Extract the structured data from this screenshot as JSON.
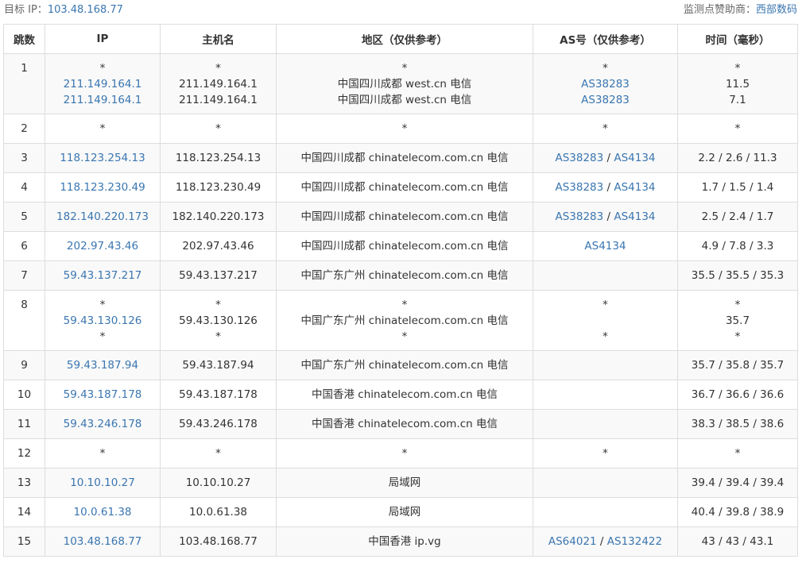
{
  "header": {
    "target_label": "目标 IP：",
    "target_ip": "103.48.168.77",
    "sponsor_label": "监测点赞助商：",
    "sponsor_name": "西部数码"
  },
  "columns": [
    "跳数",
    "IP",
    "主机名",
    "地区（仅供参考）",
    "AS号（仅供参考）",
    "时间（毫秒）"
  ],
  "rows": [
    {
      "hop": "1",
      "ip": [
        "*",
        "211.149.164.1",
        "211.149.164.1"
      ],
      "host": [
        "*",
        "211.149.164.1",
        "211.149.164.1"
      ],
      "region": [
        "*",
        "中国四川成都 west.cn 电信",
        "中国四川成都 west.cn 电信"
      ],
      "as": [
        [
          "*"
        ],
        [
          "AS38283"
        ],
        [
          "AS38283"
        ]
      ],
      "time": [
        "*",
        "11.5",
        "7.1"
      ]
    },
    {
      "hop": "2",
      "ip": [
        "*"
      ],
      "host": [
        "*"
      ],
      "region": [
        "*"
      ],
      "as": [
        [
          "*"
        ]
      ],
      "time": [
        "*"
      ]
    },
    {
      "hop": "3",
      "ip": [
        "118.123.254.13"
      ],
      "host": [
        "118.123.254.13"
      ],
      "region": [
        "中国四川成都 chinatelecom.com.cn 电信"
      ],
      "as": [
        [
          "AS38283",
          "AS4134"
        ]
      ],
      "time": [
        "2.2 / 2.6 / 11.3"
      ]
    },
    {
      "hop": "4",
      "ip": [
        "118.123.230.49"
      ],
      "host": [
        "118.123.230.49"
      ],
      "region": [
        "中国四川成都 chinatelecom.com.cn 电信"
      ],
      "as": [
        [
          "AS38283",
          "AS4134"
        ]
      ],
      "time": [
        "1.7 / 1.5 / 1.4"
      ]
    },
    {
      "hop": "5",
      "ip": [
        "182.140.220.173"
      ],
      "host": [
        "182.140.220.173"
      ],
      "region": [
        "中国四川成都 chinatelecom.com.cn 电信"
      ],
      "as": [
        [
          "AS38283",
          "AS4134"
        ]
      ],
      "time": [
        "2.5 / 2.4 / 1.7"
      ]
    },
    {
      "hop": "6",
      "ip": [
        "202.97.43.46"
      ],
      "host": [
        "202.97.43.46"
      ],
      "region": [
        "中国四川成都 chinatelecom.com.cn 电信"
      ],
      "as": [
        [
          "AS4134"
        ]
      ],
      "time": [
        "4.9 / 7.8 / 3.3"
      ]
    },
    {
      "hop": "7",
      "ip": [
        "59.43.137.217"
      ],
      "host": [
        "59.43.137.217"
      ],
      "region": [
        "中国广东广州 chinatelecom.com.cn 电信"
      ],
      "as": [
        []
      ],
      "time": [
        "35.5 / 35.5 / 35.3"
      ]
    },
    {
      "hop": "8",
      "ip": [
        "*",
        "59.43.130.126",
        "*"
      ],
      "host": [
        "*",
        "59.43.130.126",
        "*"
      ],
      "region": [
        "*",
        "中国广东广州 chinatelecom.com.cn 电信",
        "*"
      ],
      "as": [
        [
          "*"
        ],
        [],
        [
          "*"
        ]
      ],
      "time": [
        "*",
        "35.7",
        "*"
      ]
    },
    {
      "hop": "9",
      "ip": [
        "59.43.187.94"
      ],
      "host": [
        "59.43.187.94"
      ],
      "region": [
        "中国广东广州 chinatelecom.com.cn 电信"
      ],
      "as": [
        []
      ],
      "time": [
        "35.7 / 35.8 / 35.7"
      ]
    },
    {
      "hop": "10",
      "ip": [
        "59.43.187.178"
      ],
      "host": [
        "59.43.187.178"
      ],
      "region": [
        "中国香港 chinatelecom.com.cn 电信"
      ],
      "as": [
        []
      ],
      "time": [
        "36.7 / 36.6 / 36.6"
      ]
    },
    {
      "hop": "11",
      "ip": [
        "59.43.246.178"
      ],
      "host": [
        "59.43.246.178"
      ],
      "region": [
        "中国香港 chinatelecom.com.cn 电信"
      ],
      "as": [
        []
      ],
      "time": [
        "38.3 / 38.5 / 38.6"
      ]
    },
    {
      "hop": "12",
      "ip": [
        "*"
      ],
      "host": [
        "*"
      ],
      "region": [
        "*"
      ],
      "as": [
        [
          "*"
        ]
      ],
      "time": [
        "*"
      ]
    },
    {
      "hop": "13",
      "ip": [
        "10.10.10.27"
      ],
      "host": [
        "10.10.10.27"
      ],
      "region": [
        "局域网"
      ],
      "as": [
        []
      ],
      "time": [
        "39.4 / 39.4 / 39.4"
      ]
    },
    {
      "hop": "14",
      "ip": [
        "10.0.61.38"
      ],
      "host": [
        "10.0.61.38"
      ],
      "region": [
        "局域网"
      ],
      "as": [
        []
      ],
      "time": [
        "40.4 / 39.8 / 38.9"
      ]
    },
    {
      "hop": "15",
      "ip": [
        "103.48.168.77"
      ],
      "host": [
        "103.48.168.77"
      ],
      "region": [
        "中国香港 ip.vg"
      ],
      "as": [
        [
          "AS64021",
          "AS132422"
        ]
      ],
      "time": [
        "43 / 43 / 43.1"
      ]
    }
  ]
}
